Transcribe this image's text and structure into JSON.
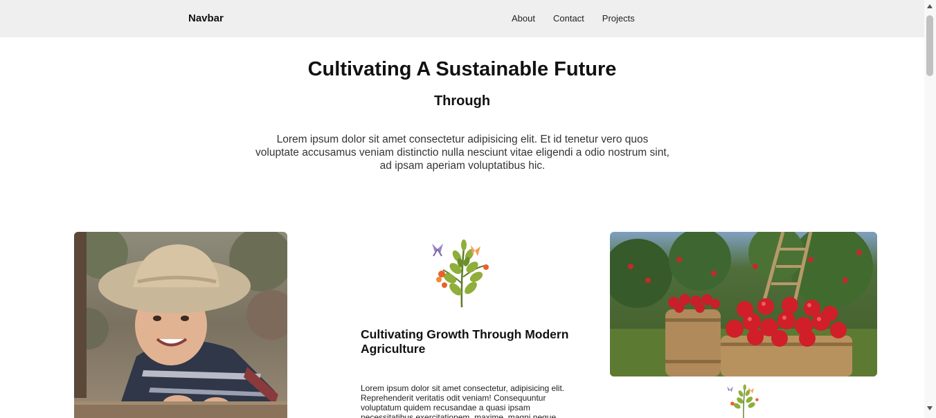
{
  "navbar": {
    "brand": "Navbar",
    "links": [
      "About",
      "Contact",
      "Projects"
    ]
  },
  "hero": {
    "title": "Cultivating A Sustainable Future",
    "subtitle": "Through",
    "text": "Lorem ipsum dolor sit amet consectetur adipisicing elit. Et id tenetur vero quos voluptate accusamus veniam distinctio nulla nesciunt vitae eligendi a odio nostrum sint, ad ipsam aperiam voluptatibus hic."
  },
  "card": {
    "title": "Cultivating Growth Through Modern Agriculture",
    "text": "Lorem ipsum dolor sit amet consectetur, adipisicing elit. Reprehenderit veritatis odit veniam! Consequuntur voluptatum quidem recusandae a quasi ipsam necessitatibus exercitationem, maxime, magni neque."
  },
  "images": {
    "left": "child-in-cowboy-hat-photo",
    "right": "apple-barrels-orchard-photo",
    "herb": "herb-sprig-illustration"
  }
}
